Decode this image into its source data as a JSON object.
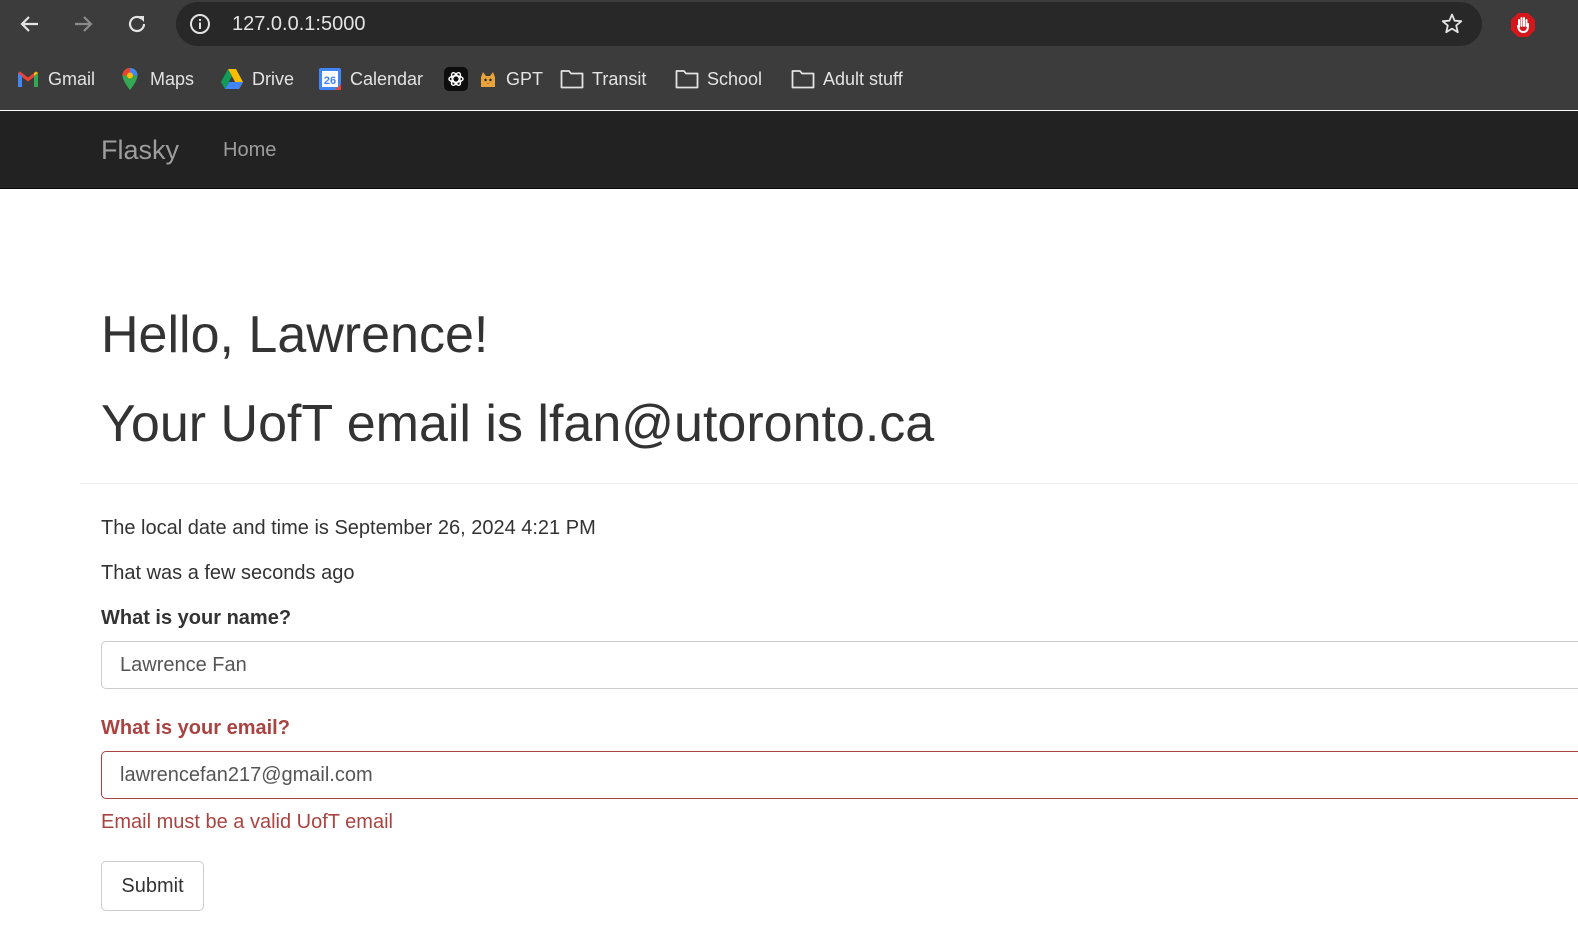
{
  "browser": {
    "url": "127.0.0.1:5000",
    "bookmarks": [
      {
        "label": "Gmail",
        "icon": "gmail-icon"
      },
      {
        "label": "Maps",
        "icon": "maps-icon"
      },
      {
        "label": "Drive",
        "icon": "drive-icon"
      },
      {
        "label": "Calendar",
        "icon": "calendar-icon",
        "badge": "26"
      },
      {
        "label": "",
        "icon": "openai-icon"
      },
      {
        "label": "GPT",
        "icon": "cat-icon"
      },
      {
        "label": "Transit",
        "icon": "folder-icon"
      },
      {
        "label": "School",
        "icon": "folder-icon"
      },
      {
        "label": "Adult stuff",
        "icon": "folder-icon"
      }
    ]
  },
  "navbar": {
    "brand": "Flasky",
    "links": [
      "Home"
    ]
  },
  "page": {
    "greeting": "Hello, Lawrence!",
    "email_line": "Your UofT email is lfan@utoronto.ca",
    "datetime_line": "The local date and time is September 26, 2024 4:21 PM",
    "relative_time": "That was a few seconds ago"
  },
  "form": {
    "name_label": "What is your name?",
    "name_value": "Lawrence Fan",
    "email_label": "What is your email?",
    "email_value": "lawrencefan217@gmail.com",
    "email_error": "Email must be a valid UofT email",
    "submit_label": "Submit"
  },
  "colors": {
    "navbar_bg": "#222222",
    "error": "#a94442",
    "chrome_bg": "#3c3c3c"
  }
}
